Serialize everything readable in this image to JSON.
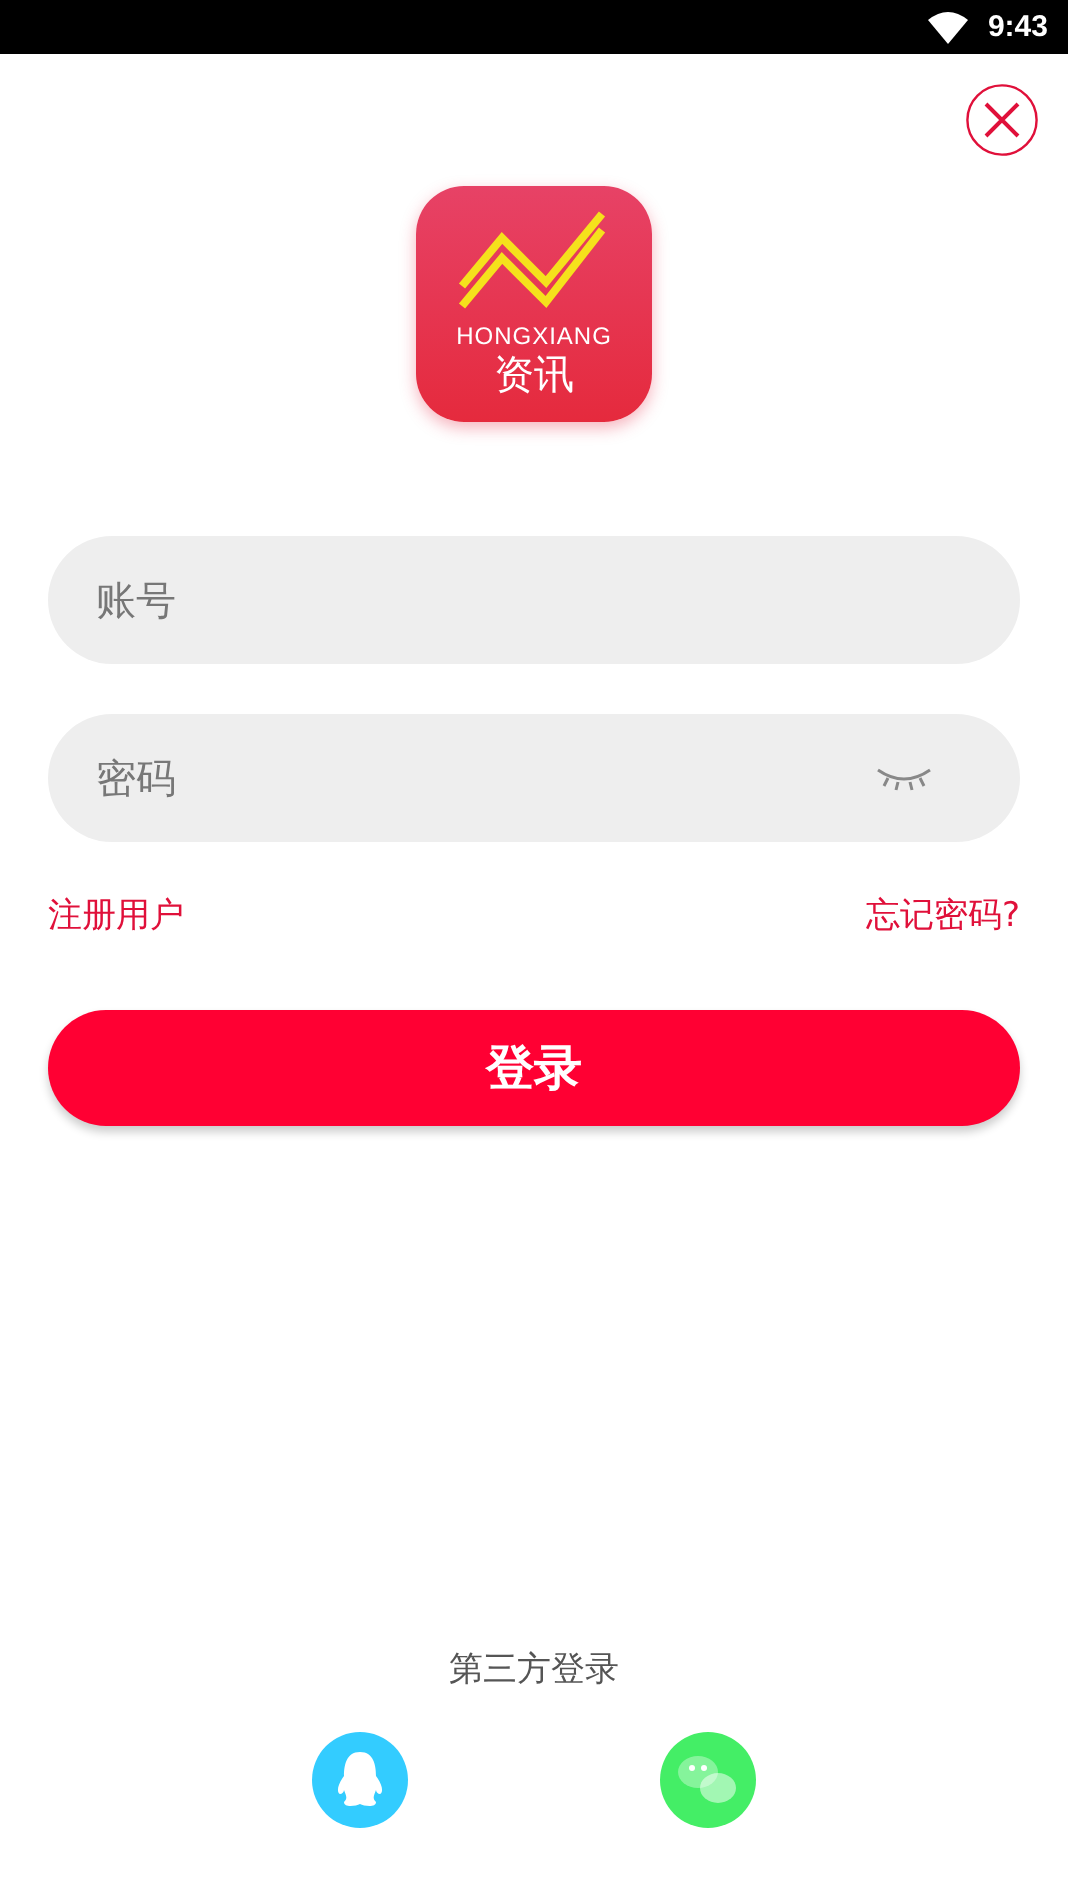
{
  "status_bar": {
    "time": "9:43"
  },
  "logo": {
    "latin": "HONGXIANG",
    "chinese": "资讯"
  },
  "fields": [
    {
      "kind": "text",
      "placeholder": "账号"
    },
    {
      "kind": "password",
      "placeholder": "密码"
    }
  ],
  "links": {
    "register": "注册用户",
    "forgot": "忘记密码?"
  },
  "login_button": "登录",
  "third_party": {
    "title": "第三方登录",
    "providers": [
      {
        "kind": "qq",
        "color": "#33ccff"
      },
      {
        "kind": "wechat",
        "color": "#44ee66"
      }
    ]
  }
}
